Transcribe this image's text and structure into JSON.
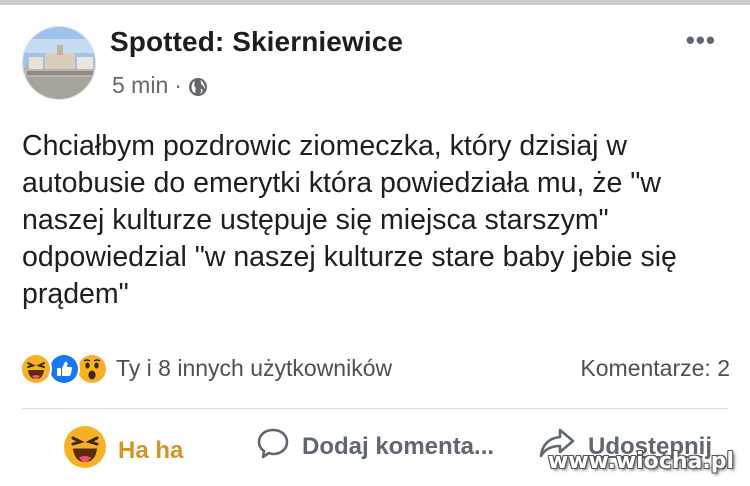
{
  "post": {
    "page_name": "Spotted: Skierniewice",
    "time": "5 min",
    "separator": "·",
    "privacy_icon": "globe-icon",
    "more_label": "•••",
    "text": "Chciałbym pozdrowic ziomeczka, który dzisiaj w autobusie do emerytki która powiedziała mu, że \"w naszej kulturze ustępuje się miejsca starszym\" odpowiedzial \"w naszej kulturze stare baby jebie się prądem\""
  },
  "reactions": {
    "icons": [
      "haha-emoji-icon",
      "like-icon",
      "wow-emoji-icon"
    ],
    "summary": "Ty i 8 innych użytkowników",
    "comments": "Komentarze: 2"
  },
  "actions": {
    "haha_label": "Ha ha",
    "comment_label": "Dodaj komenta...",
    "share_label": "Udostępnij"
  },
  "watermark": "www.wiocha.pl",
  "colors": {
    "haha_active": "#d19628",
    "like_blue": "#1877f2",
    "text": "#1c1e21",
    "muted": "#65676b"
  }
}
